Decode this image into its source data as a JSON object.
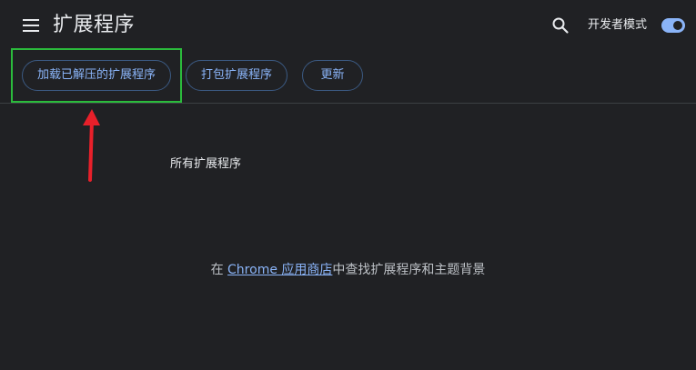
{
  "header": {
    "title": "扩展程序",
    "menu_icon": "hamburger-menu-icon",
    "search_icon": "search-icon",
    "developer_mode_label": "开发者模式",
    "developer_mode_on": true
  },
  "toolbar": {
    "load_unpacked_label": "加载已解压的扩展程序",
    "pack_label": "打包扩展程序",
    "update_label": "更新"
  },
  "main": {
    "section_label": "所有扩展程序",
    "store_prefix": "在 ",
    "store_link_label": "Chrome 应用商店",
    "store_suffix": "中查找扩展程序和主题背景"
  },
  "annotation": {
    "highlight_color": "#2bbb3c",
    "arrow_color": "#e8202a"
  },
  "colors": {
    "background": "#202124",
    "accent": "#8ab4f8",
    "text": "#e8eaed"
  }
}
